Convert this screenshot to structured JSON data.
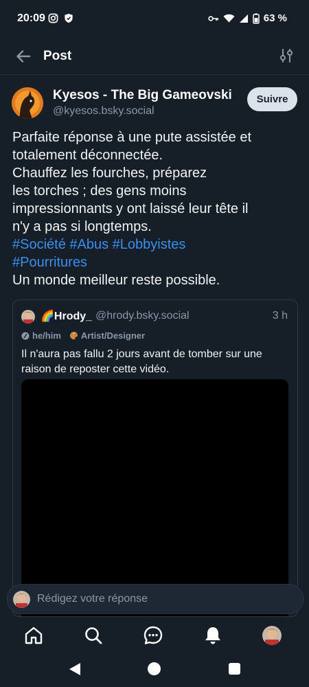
{
  "status": {
    "time": "20:09",
    "battery": "63 %",
    "icons_left": [
      "instagram-icon",
      "shield-icon"
    ],
    "icons_right": [
      "key-icon",
      "wifi-icon",
      "signal-icon",
      "battery-icon"
    ]
  },
  "header": {
    "title": "Post"
  },
  "post": {
    "author_name": "Kyesos - The Big Gameovski",
    "author_handle": "@kyesos.bsky.social",
    "follow_label": "Suivre",
    "lines": [
      "Parfaite réponse à une pute assistée et",
      "totalement déconnectée.",
      "Chauffez les fourches, préparez",
      "les torches ; des gens moins",
      "impressionnants y ont laissé leur tête il",
      "n'y a pas si longtemps."
    ],
    "hashtags_line1": "#Société #Abus #Lobbyistes",
    "hashtags_line2": "#Pourritures",
    "closing": "Un monde meilleur reste possible."
  },
  "quote": {
    "name": "🌈Hrody_",
    "handle": "@hrody.bsky.social",
    "time": "3 h",
    "badge_pronouns": "he/him",
    "badge_role": "Artist/Designer",
    "text": "Il n'aura pas fallu 2 jours avant de tomber sur une raison de reposter cette vidéo."
  },
  "reply": {
    "placeholder": "Rédigez votre réponse"
  },
  "tabs": [
    "home-icon",
    "search-icon",
    "chat-icon",
    "bell-icon",
    "profile-avatar"
  ],
  "colors": {
    "background": "#161e27",
    "accent_link": "#3b8ff0",
    "muted_text": "#8b98a8",
    "follow_button": "#dce2ea"
  }
}
